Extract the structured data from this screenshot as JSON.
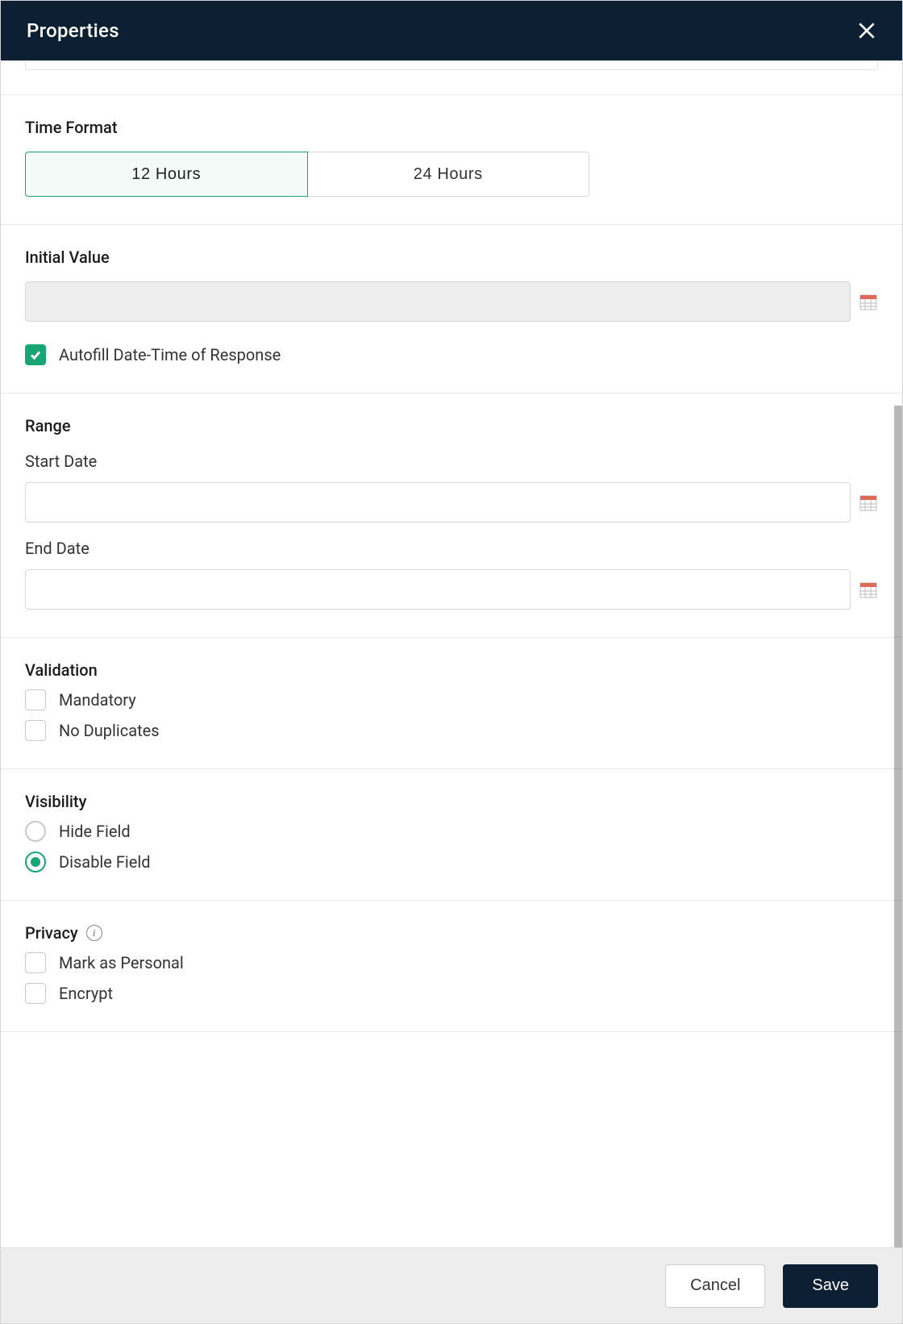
{
  "header": {
    "title": "Properties"
  },
  "timeFormat": {
    "title": "Time Format",
    "options": {
      "opt12": "12 Hours",
      "opt24": "24 Hours"
    },
    "selected": "12"
  },
  "initialValue": {
    "title": "Initial Value",
    "value": "",
    "autofill": {
      "label": "Autofill Date-Time of Response",
      "checked": true
    }
  },
  "range": {
    "title": "Range",
    "start": {
      "label": "Start Date",
      "value": ""
    },
    "end": {
      "label": "End Date",
      "value": ""
    }
  },
  "validation": {
    "title": "Validation",
    "mandatory": {
      "label": "Mandatory",
      "checked": false
    },
    "noDuplicates": {
      "label": "No Duplicates",
      "checked": false
    }
  },
  "visibility": {
    "title": "Visibility",
    "options": {
      "hide": "Hide Field",
      "disable": "Disable Field"
    },
    "selected": "disable"
  },
  "privacy": {
    "title": "Privacy",
    "markPersonal": {
      "label": "Mark as Personal",
      "checked": false
    },
    "encrypt": {
      "label": "Encrypt",
      "checked": false
    }
  },
  "footer": {
    "cancel": "Cancel",
    "save": "Save"
  }
}
